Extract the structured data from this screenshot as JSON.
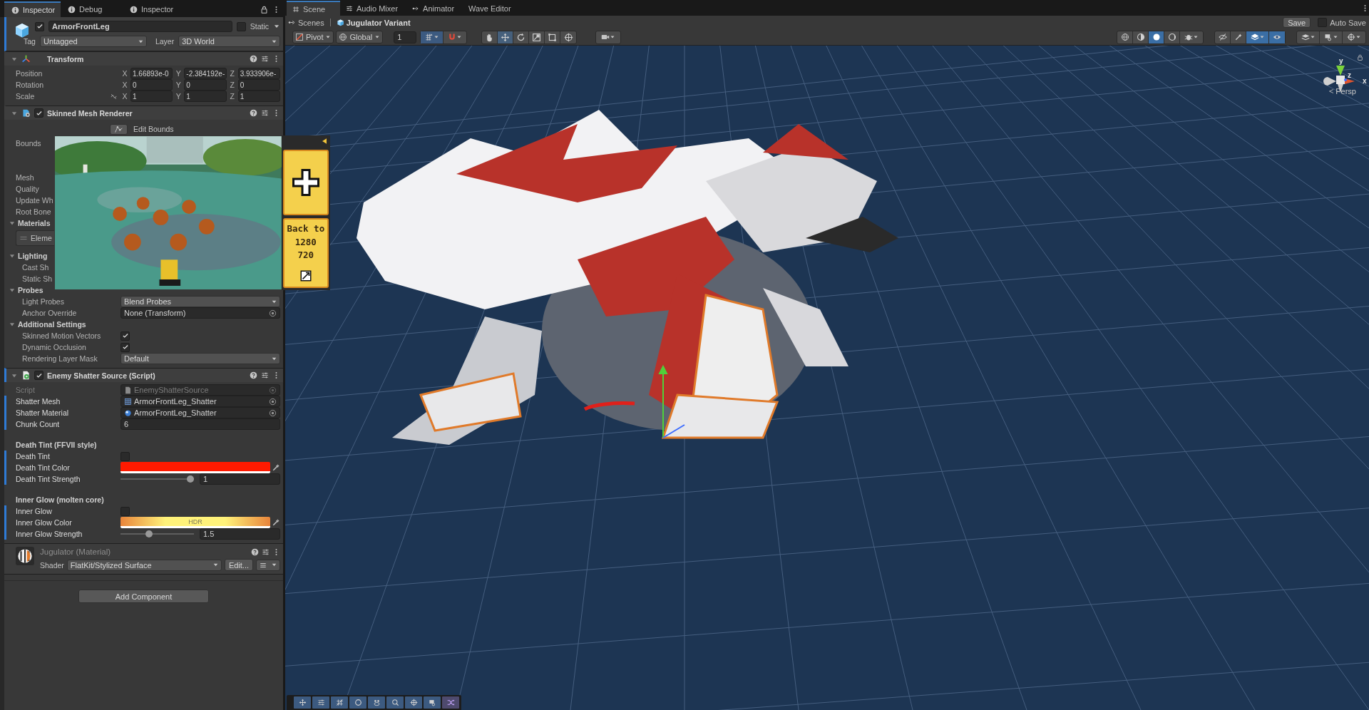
{
  "inspector_tabs": [
    {
      "label": "Inspector",
      "selected": true
    },
    {
      "label": "Debug",
      "selected": false
    },
    {
      "label": "Inspector",
      "selected": false
    }
  ],
  "object": {
    "active": true,
    "overridden": true,
    "name": "ArmorFrontLeg",
    "static": false,
    "static_label": "Static",
    "tag_label": "Tag",
    "tag": "Untagged",
    "layer_label": "Layer",
    "layer": "3D World"
  },
  "components": [
    {
      "title": "Transform",
      "expanded": true,
      "overridden": false,
      "rows": [
        {
          "kind": "vector",
          "label": "Position",
          "values": [
            {
              "axis": "X",
              "value": "1.66893e-0"
            },
            {
              "axis": "Y",
              "value": "-2.384192e-"
            },
            {
              "axis": "Z",
              "value": "3.933906e-"
            }
          ]
        },
        {
          "kind": "vector",
          "label": "Rotation",
          "values": [
            {
              "axis": "X",
              "value": "0"
            },
            {
              "axis": "Y",
              "value": "0"
            },
            {
              "axis": "Z",
              "value": "0"
            }
          ]
        },
        {
          "kind": "vector",
          "label": "Scale",
          "constrained": false,
          "values": [
            {
              "axis": "X",
              "value": "1"
            },
            {
              "axis": "Y",
              "value": "1"
            },
            {
              "axis": "Z",
              "value": "1"
            }
          ]
        }
      ]
    },
    {
      "title": "Skinned Mesh Renderer",
      "enabled": true,
      "expanded": true,
      "overridden": false,
      "rows": [
        {
          "kind": "button",
          "label": "Edit Bounds"
        },
        {
          "kind": "bounds",
          "label": "Bounds"
        },
        {
          "kind": "label",
          "label": "Mesh"
        },
        {
          "kind": "label",
          "label": "Quality"
        },
        {
          "kind": "label",
          "label": "Update Wh"
        },
        {
          "kind": "label",
          "label": "Root Bone"
        },
        {
          "kind": "section",
          "label": "Materials",
          "expanded": true,
          "children": [
            {
              "kind": "element",
              "label": "Eleme"
            }
          ]
        },
        {
          "kind": "section",
          "label": "Lighting",
          "expanded": true,
          "children": [
            {
              "kind": "label",
              "label": "Cast Sh"
            },
            {
              "kind": "label",
              "label": "Static Sh"
            }
          ]
        },
        {
          "kind": "section",
          "label": "Probes",
          "expanded": true,
          "children": [
            {
              "kind": "dropdown",
              "label": "Light Probes",
              "value": "Blend Probes"
            },
            {
              "kind": "object",
              "label": "Anchor Override",
              "value": "None (Transform)",
              "disabled": false
            }
          ]
        },
        {
          "kind": "section",
          "label": "Additional Settings",
          "expanded": true,
          "children": [
            {
              "kind": "toggle",
              "label": "Skinned Motion Vectors",
              "checked": true
            },
            {
              "kind": "toggle",
              "label": "Dynamic Occlusion",
              "checked": true
            },
            {
              "kind": "dropdown",
              "label": "Rendering Layer Mask",
              "value": "Default"
            }
          ]
        }
      ]
    },
    {
      "title": "Enemy Shatter Source (Script)",
      "enabled": true,
      "expanded": true,
      "overridden": true,
      "rows": [
        {
          "kind": "object",
          "label": "Script",
          "value": "EnemyShatterSource",
          "disabled": true,
          "overridden": false
        },
        {
          "kind": "object",
          "label": "Shatter Mesh",
          "value": "ArmorFrontLeg_Shatter",
          "disabled": false,
          "overridden": true
        },
        {
          "kind": "object",
          "label": "Shatter Material",
          "value": "ArmorFrontLeg_Shatter",
          "disabled": false,
          "overridden": true
        },
        {
          "kind": "number",
          "label": "Chunk Count",
          "value": "6",
          "overridden": true
        },
        {
          "kind": "header",
          "label": "Death Tint (FFVII style)",
          "overridden": false
        },
        {
          "kind": "toggle",
          "label": "Death Tint",
          "checked": false,
          "overridden": true
        },
        {
          "kind": "color",
          "label": "Death Tint Color",
          "color": "#ff1a00",
          "overridden": true
        },
        {
          "kind": "slider",
          "label": "Death Tint Strength",
          "level": 1,
          "value": "1",
          "overridden": true
        },
        {
          "kind": "header",
          "label": "Inner Glow (molten core)",
          "overridden": false
        },
        {
          "kind": "toggle",
          "label": "Inner Glow",
          "checked": false,
          "overridden": true
        },
        {
          "kind": "color",
          "label": "Inner Glow Color",
          "color": "#fff27a",
          "hdr_text": "HDR",
          "overridden": true
        },
        {
          "kind": "slider",
          "label": "Inner Glow Strength",
          "level": 0.38,
          "value": "1.5",
          "overridden": true
        }
      ]
    }
  ],
  "material": {
    "name": "Jugulator (Material)",
    "shader_label": "Shader",
    "shader": "FlatKit/Stylized Surface",
    "edit": "Edit..."
  },
  "add_component": "Add Component",
  "game_overlay": {
    "back_lines": [
      "Back to",
      "1280",
      "720"
    ]
  },
  "scene_tabs": [
    {
      "label": "Scene",
      "selected": true
    },
    {
      "label": "Audio Mixer",
      "selected": false
    },
    {
      "label": "Animator",
      "selected": false
    },
    {
      "label": "Wave Editor",
      "selected": false
    }
  ],
  "breadcrumb": [
    "Scenes",
    "Jugulator Variant"
  ],
  "save": "Save",
  "auto_save": {
    "label": "Auto Save",
    "checked": false
  },
  "scene_toolbar": {
    "pivot": "Pivot",
    "global": "Global",
    "grid_size": "1",
    "tools": [
      {
        "selected": false
      },
      {
        "selected": true
      },
      {
        "selected": false
      },
      {
        "selected": false
      },
      {
        "selected": false
      },
      {
        "selected": false
      }
    ],
    "view_toggles": [
      {
        "selected": false
      },
      {
        "selected": false
      },
      {
        "selected": true
      },
      {
        "selected": false
      },
      {
        "selected": false
      },
      {
        "selected": false
      },
      {
        "selected": false
      },
      {
        "selected": true
      },
      {
        "selected": true
      },
      {
        "selected": false
      },
      {
        "selected": false
      },
      {
        "selected": false
      }
    ]
  },
  "gizmo": {
    "y": "y",
    "z": "z",
    "x": "x",
    "projection": "Persp"
  },
  "overlay_tools": [
    {
      "selected": false
    },
    {
      "selected": false
    },
    {
      "selected": false
    },
    {
      "selected": false
    },
    {
      "selected": false
    },
    {
      "selected": false
    },
    {
      "selected": false
    },
    {
      "selected": false
    },
    {
      "selected": true
    }
  ]
}
